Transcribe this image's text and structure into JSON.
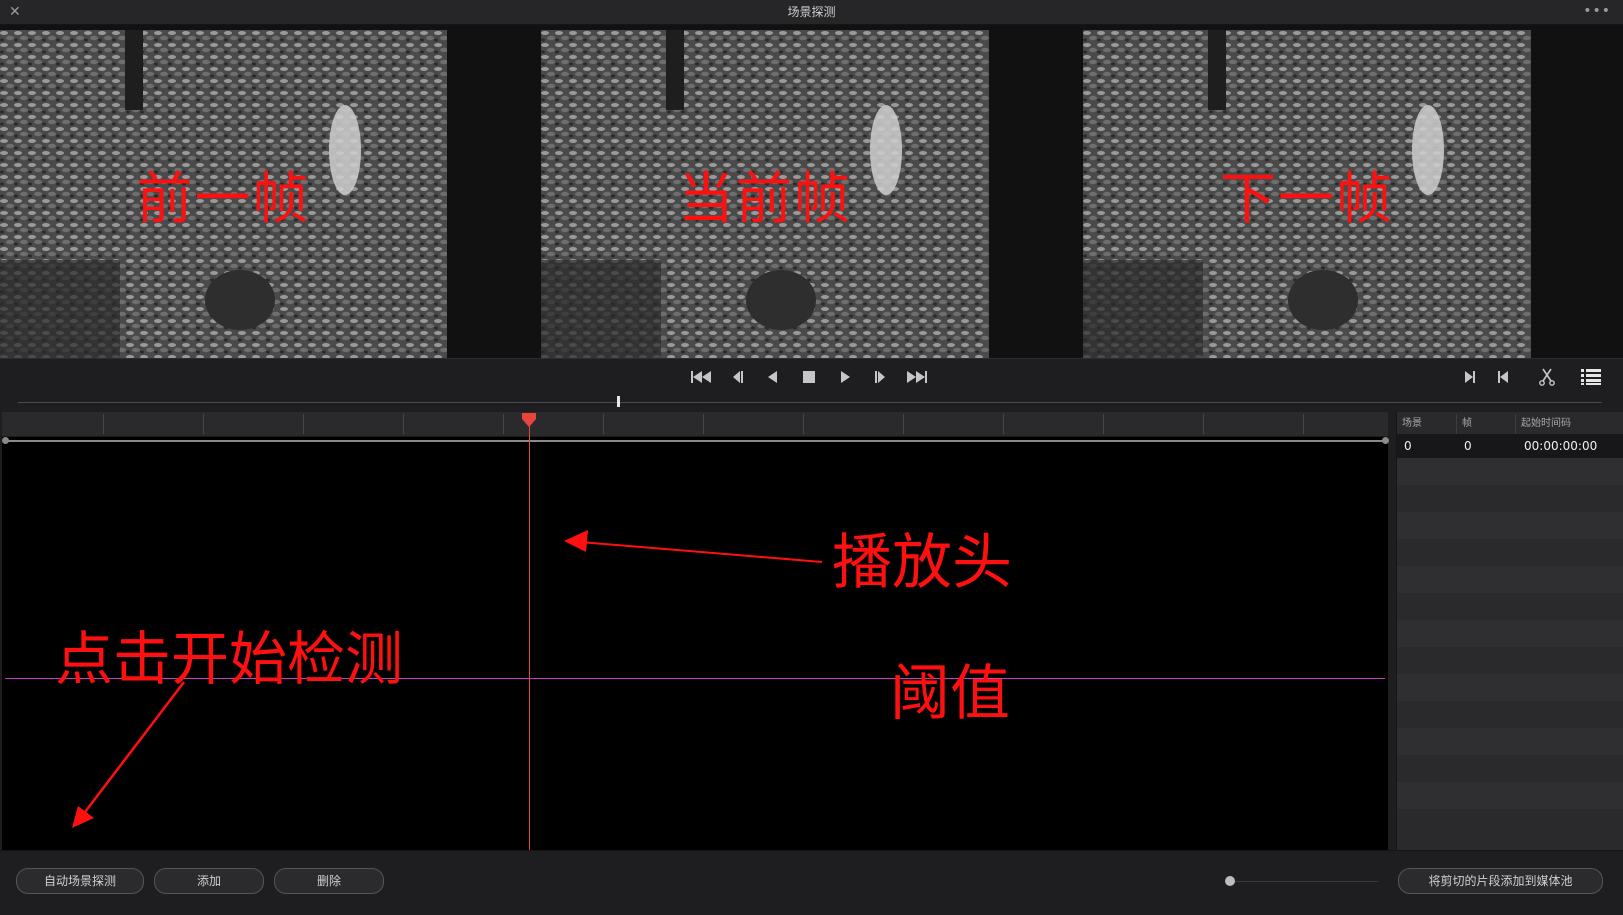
{
  "window": {
    "title": "场景探测",
    "close_icon": "close-icon",
    "more_icon": "more-options-icon"
  },
  "viewer": {
    "frames": [
      {
        "name": "previous-frame",
        "label": "前一帧"
      },
      {
        "name": "current-frame",
        "label": "当前帧"
      },
      {
        "name": "next-frame",
        "label": "下一帧"
      }
    ]
  },
  "transport": {
    "buttons": [
      "go-to-start-icon",
      "step-back-icon",
      "play-reverse-icon",
      "stop-icon",
      "play-icon",
      "step-forward-icon",
      "go-to-end-icon"
    ],
    "right_buttons": [
      "previous-cut-icon",
      "next-cut-icon",
      "scissors-icon",
      "list-view-icon"
    ]
  },
  "annotations": {
    "playhead": "播放头",
    "threshold": "阈值",
    "start_detect": "点击开始检测"
  },
  "scene_list": {
    "columns": [
      "场景",
      "帧",
      "起始时间码"
    ],
    "rows": [
      {
        "scene": "0",
        "frame": "0",
        "timecode": "00:00:00:00"
      }
    ]
  },
  "bottom": {
    "auto_detect": "自动场景探测",
    "add": "添加",
    "delete": "删除",
    "add_to_pool": "将剪切的片段添加到媒体池"
  },
  "colors": {
    "playhead": "#e8453c",
    "threshold": "#c83cc8",
    "annotation": "#ff1010"
  }
}
